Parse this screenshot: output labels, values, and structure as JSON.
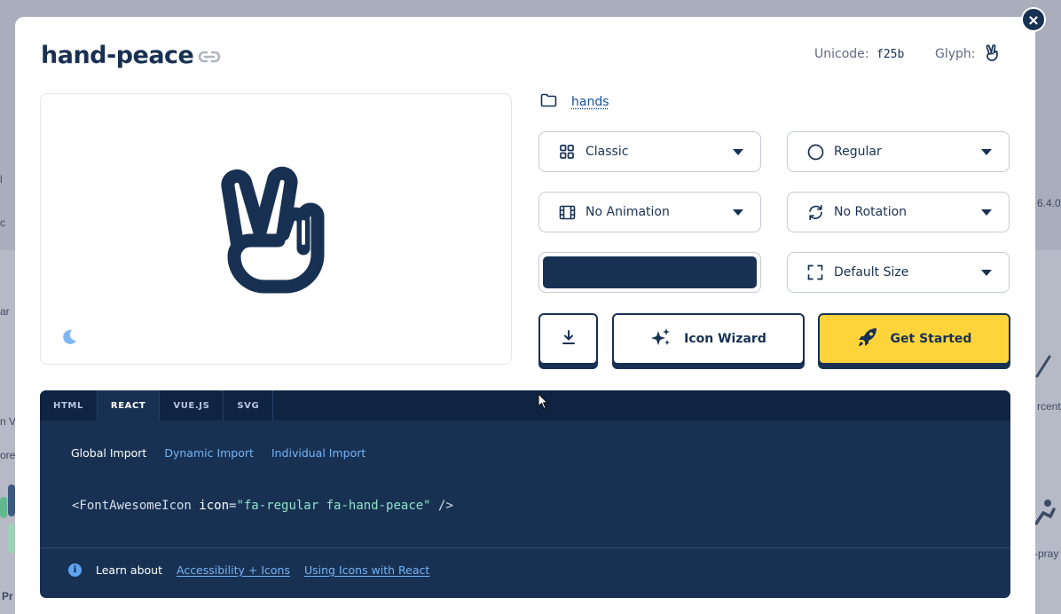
{
  "background": {
    "fragments": [
      "l",
      "c",
      "ar",
      "n V",
      "ore",
      "Pr",
      "6.4.0",
      "rcent",
      "-pray"
    ]
  },
  "modal": {
    "title": "hand-peace",
    "unicode_label": "Unicode:",
    "unicode_value": "f25b",
    "glyph_label": "Glyph:",
    "category": "hands",
    "selects": {
      "family": "Classic",
      "style": "Regular",
      "animation": "No Animation",
      "rotation": "No Rotation",
      "size": "Default Size"
    },
    "color_value": "#183153",
    "buttons": {
      "wizard": "Icon Wizard",
      "get_started": "Get Started"
    }
  },
  "code_panel": {
    "tabs": [
      "HTML",
      "REACT",
      "VUE.JS",
      "SVG"
    ],
    "active_tab": "REACT",
    "subtabs": [
      "Global Import",
      "Dynamic Import",
      "Individual Import"
    ],
    "code": {
      "prefix": "<FontAwesomeIcon ",
      "attr": "icon",
      "eq": "=",
      "value": "\"fa-regular fa-hand-peace\"",
      "suffix": " />"
    },
    "learn_label": "Learn about",
    "learn_links": [
      "Accessibility + Icons",
      "Using Icons with React"
    ]
  },
  "colors": {
    "navy": "#183153",
    "accent_yellow": "#ffd43b",
    "link_blue": "#74b4f5"
  }
}
